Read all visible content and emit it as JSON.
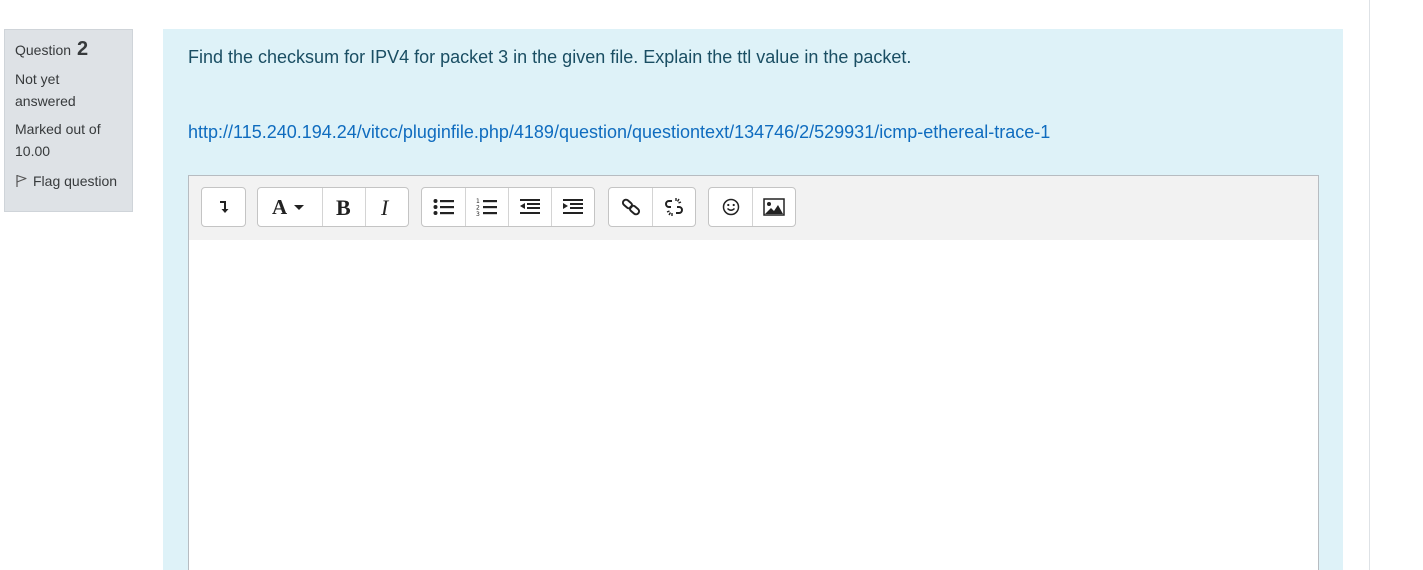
{
  "info": {
    "question_label": "Question",
    "question_number": "2",
    "state": "Not yet answered",
    "grade": "Marked out of 10.00",
    "flag_label": "Flag question"
  },
  "question": {
    "text": "Find the checksum for IPV4 for packet 3 in the given file. Explain the ttl value in the packet.",
    "link": "http://115.240.194.24/vitcc/pluginfile.php/4189/question/questiontext/134746/2/529931/icmp-ethereal-trace-1"
  },
  "toolbar": {
    "items": [
      "toolbar-toggle",
      "font-style",
      "bold",
      "italic",
      "unordered-list",
      "ordered-list",
      "outdent",
      "indent",
      "link",
      "unlink",
      "emoticon",
      "image"
    ]
  },
  "colors": {
    "info_bg": "#dee2e6",
    "content_bg": "#def2f8",
    "link": "#0f6cbf",
    "text": "#1a4e63"
  }
}
